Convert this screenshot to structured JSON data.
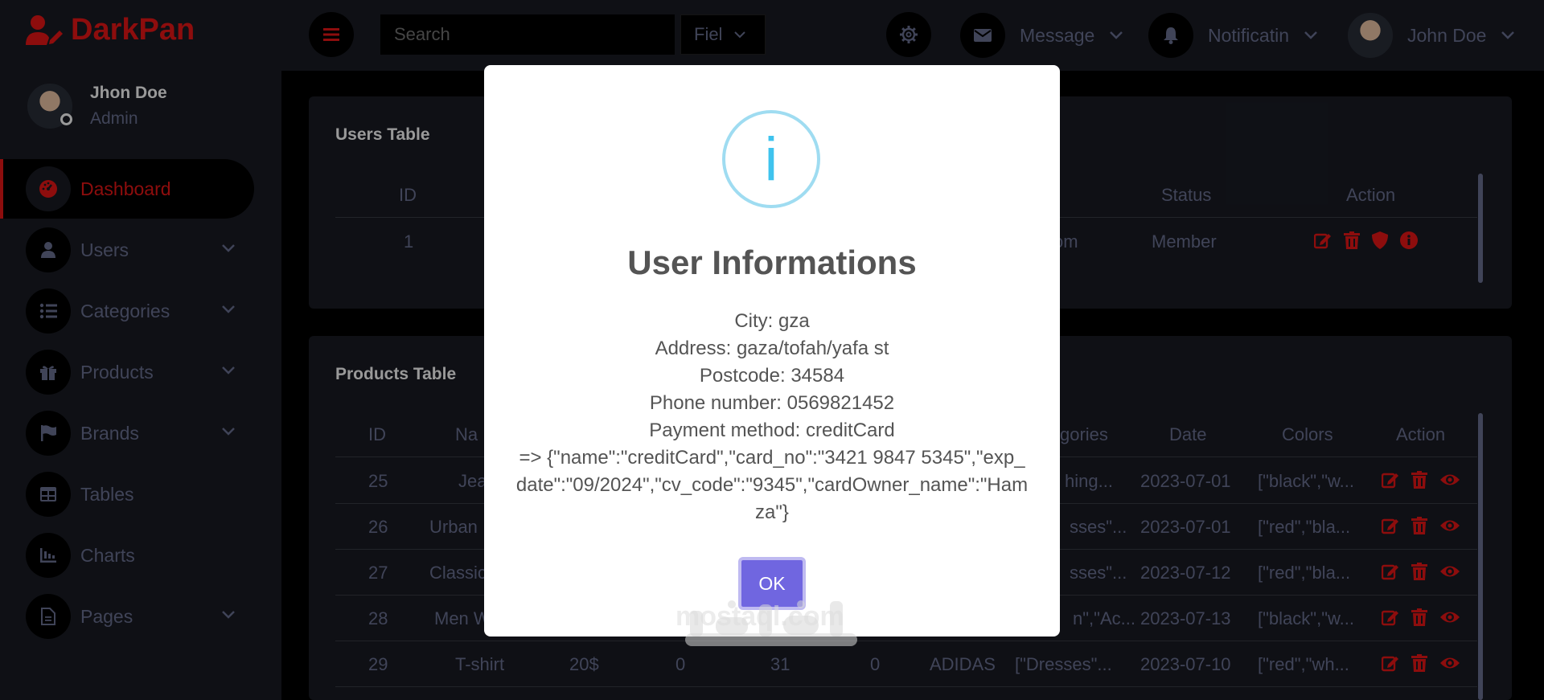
{
  "app": {
    "brand": "DarkPan"
  },
  "sidebar": {
    "user": {
      "name": "Jhon Doe",
      "role": "Admin"
    },
    "items": [
      {
        "label": "Dashboard",
        "icon": "tachometer-icon",
        "active": true,
        "chevron": false
      },
      {
        "label": "Users",
        "icon": "user-icon",
        "active": false,
        "chevron": true
      },
      {
        "label": "Categories",
        "icon": "list-icon",
        "active": false,
        "chevron": true
      },
      {
        "label": "Products",
        "icon": "gift-icon",
        "active": false,
        "chevron": true
      },
      {
        "label": "Brands",
        "icon": "flag-icon",
        "active": false,
        "chevron": true
      },
      {
        "label": "Tables",
        "icon": "table-icon",
        "active": false,
        "chevron": false
      },
      {
        "label": "Charts",
        "icon": "chart-icon",
        "active": false,
        "chevron": false
      },
      {
        "label": "Pages",
        "icon": "file-icon",
        "active": false,
        "chevron": true
      }
    ]
  },
  "topbar": {
    "search_placeholder": "Search",
    "field_select": "Fiel",
    "message_label": "Message",
    "notification_label": "Notificatin",
    "user_name": "John Doe"
  },
  "users_table": {
    "title": "Users Table",
    "headers": {
      "id": "ID",
      "status": "Status",
      "action": "Action"
    },
    "row": {
      "id": "1",
      "email_fragment": "om",
      "status": "Member"
    }
  },
  "products_table": {
    "title": "Products Table",
    "headers": {
      "id": "ID",
      "name": "Na",
      "categories": "gories",
      "date": "Date",
      "colors": "Colors",
      "action": "Action"
    },
    "rows": [
      {
        "id": "25",
        "name": "Jea",
        "categories": "hing...",
        "date": "2023-07-01",
        "colors": "[\"black\",\"w..."
      },
      {
        "id": "26",
        "name": "Urban",
        "categories": "sses\"...",
        "date": "2023-07-01",
        "colors": "[\"red\",\"bla..."
      },
      {
        "id": "27",
        "name": "Classic",
        "categories": "sses\"...",
        "date": "2023-07-12",
        "colors": "[\"red\",\"bla..."
      },
      {
        "id": "28",
        "name": "Men W",
        "categories": "n\",\"Ac...",
        "date": "2023-07-13",
        "colors": "[\"black\",\"w..."
      },
      {
        "id": "29",
        "name": "T-shirt",
        "price": "20$",
        "qty": "0",
        "stock": "31",
        "discount": "0",
        "brand": "ADIDAS",
        "categories": "[\"Dresses\"...",
        "date": "2023-07-10",
        "colors": "[\"red\",\"wh..."
      }
    ]
  },
  "modal": {
    "icon": "i",
    "title": "User Informations",
    "lines": [
      "City: gza",
      "Address: gaza/tofah/yafa st",
      "Postcode: 34584",
      "Phone number: 0569821452",
      "Payment method: creditCard",
      "=> {\"name\":\"creditCard\",\"card_no\":\"3421 9847 5345\",\"exp_date\":\"09/2024\",\"cv_code\":\"9345\",\"cardOwner_name\":\"Hamza\"}"
    ],
    "ok_label": "OK"
  },
  "watermark": {
    "latin": "mostaql.com"
  },
  "colors": {
    "accent": "#eb1616",
    "bg": "#000000",
    "panel": "#191c24",
    "muted": "#6c7293",
    "ok": "#7066e0",
    "info": "#3fc3ee"
  }
}
